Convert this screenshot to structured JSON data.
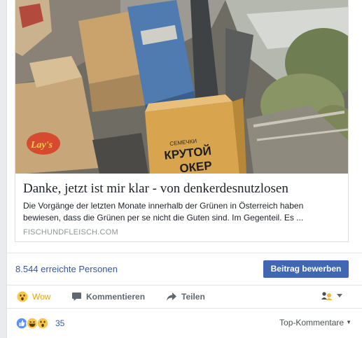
{
  "link_preview": {
    "image_alt": "Haufen von alten Kartons und Müll",
    "box_text_1": "Lay's",
    "box_text_2": "СЕМЕЧКИ",
    "box_text_3": "КРУТОЙ",
    "box_text_4": "ОКЕР",
    "title": "Danke, jetzt ist mir klar - von denkerdesnutzlosen",
    "description": "Die Vorgänge der letzten Monate innerhalb der Grünen in Österreich haben bewiesen, dass die Grünen per se nicht die Guten sind. Im Gegenteil. Es ...",
    "domain": "FISCHUNDFLEISCH.COM"
  },
  "stats": {
    "reach": "8.544 erreichte Personen",
    "boost_label": "Beitrag bewerben"
  },
  "actions": {
    "wow_label": "Wow",
    "comment_label": "Kommentieren",
    "share_label": "Teilen"
  },
  "summary": {
    "reaction_count": "35",
    "top_comments_label": "Top-Kommentare"
  },
  "icons": {
    "wow": "wow-emoji-icon",
    "comment": "comment-bubble-icon",
    "share": "share-arrow-icon",
    "audience": "audience-selector-icon",
    "like": "like-reaction-icon",
    "haha": "haha-reaction-icon"
  },
  "colors": {
    "link": "#365899",
    "button": "#4267b2",
    "wow": "#e9a60c",
    "secondary_text": "#90949c"
  }
}
